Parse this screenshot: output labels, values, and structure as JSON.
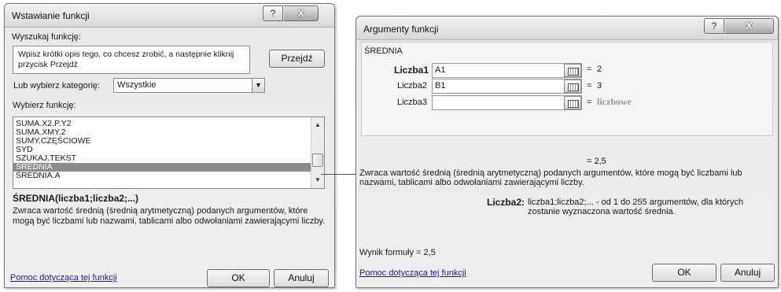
{
  "left_dialog": {
    "title": "Wstawianie funkcji",
    "search_label": "Wyszukaj funkcję:",
    "search_value": "Wpisz krótki opis tego, co chcesz zrobić, a następnie kliknij przycisk Przejdź",
    "go_button": "Przejdź",
    "category_label": "Lub wybierz kategorię:",
    "category_value": "Wszystkie",
    "select_label": "Wybierz funkcję:",
    "functions": [
      "SUMA.X2.P.Y2",
      "SUMA.XMY.2",
      "SUMY.CZĘŚCIOWE",
      "SYD",
      "SZUKAJ.TEKST",
      "ŚREDNIA",
      "ŚREDNIA.A"
    ],
    "selected_index": 5,
    "signature": "ŚREDNIA(liczba1;liczba2;...)",
    "description": "Zwraca wartość średnią (średnią arytmetyczną) podanych argumentów, które mogą być liczbami lub nazwami, tablicami albo odwołaniami zawierającymi liczby.",
    "help_link": "Pomoc dotycząca tej funkcji",
    "ok_button": "OK",
    "cancel_button": "Anuluj"
  },
  "right_dialog": {
    "title": "Argumenty funkcji",
    "function_name": "ŚREDNIA",
    "args": [
      {
        "label": "Liczba1",
        "value": "A1",
        "result": "2",
        "bold": true
      },
      {
        "label": "Liczba2",
        "value": "B1",
        "result": "3",
        "bold": false
      },
      {
        "label": "Liczba3",
        "value": "",
        "result": "liczbowe",
        "bold": false
      }
    ],
    "equals": "=",
    "total_result": "= 2,5",
    "description": "Zwraca wartość średnią (średnią arytmetyczną) podanych argumentów, które mogą być liczbami lub nazwami, tablicami albo odwołaniami zawierającymi liczby.",
    "arg_help_label": "Liczba2:",
    "arg_help_text": "liczba1;liczba2;... - od 1 do 255 argumentów, dla których zostanie wyznaczona wartość średnia.",
    "formula_result": "Wynik formuły =  2,5",
    "help_link": "Pomoc dotycząca tej funkcji",
    "ok_button": "OK",
    "cancel_button": "Anuluj"
  },
  "titlebar_buttons": {
    "help": "?",
    "close": "X"
  },
  "icons": {
    "dropdown": "chevron-down-icon",
    "scroll_up": "scroll-up-icon",
    "scroll_down": "scroll-down-icon",
    "ref": "collapse-dialog-icon"
  }
}
